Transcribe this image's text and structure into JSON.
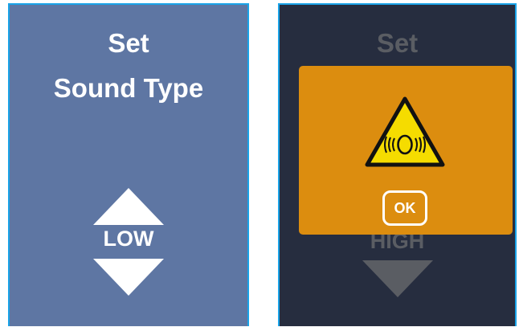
{
  "left_screen": {
    "title_line1": "Set",
    "title_line2": "Sound Type",
    "level": "LOW",
    "icons": [
      "arrow-up-icon",
      "arrow-down-icon"
    ],
    "colors": {
      "background": "#5e76a3",
      "text": "#ffffff",
      "border": "#1aa3e8"
    }
  },
  "right_screen": {
    "title_line1": "Set",
    "level": "HIGH",
    "colors": {
      "background": "#262d3f",
      "dimmed_text": "#5a5d63",
      "border": "#1aa3e8"
    },
    "dialog": {
      "icon": "loud-noise-warning-icon",
      "ok_label": "OK",
      "colors": {
        "background": "#dc8d0f",
        "warning_yellow": "#f5dc00"
      }
    }
  }
}
